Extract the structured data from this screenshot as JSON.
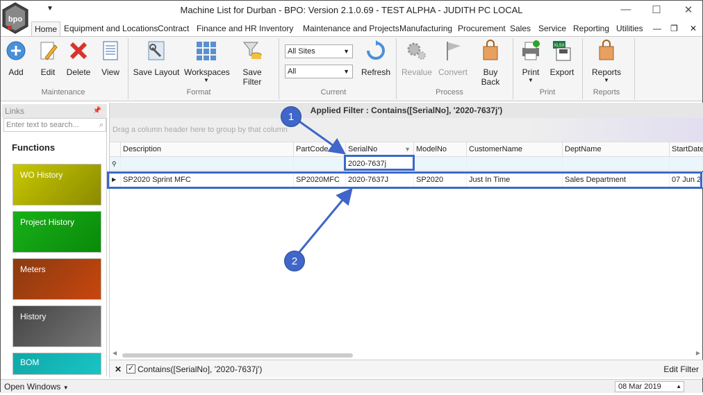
{
  "window": {
    "title": "Machine List for Durban - BPO: Version 2.1.0.69 - TEST ALPHA - JUDITH PC LOCAL",
    "logo_text": "bpo"
  },
  "menu": {
    "tabs": [
      "Home",
      "Equipment and Locations",
      "Contract",
      "Finance and HR",
      "Inventory",
      "Maintenance and Projects",
      "Manufacturing",
      "Procurement",
      "Sales",
      "Service",
      "Reporting",
      "Utilities"
    ]
  },
  "ribbon": {
    "maintenance": {
      "add": "Add",
      "edit": "Edit",
      "delete": "Delete",
      "view": "View",
      "label": "Maintenance"
    },
    "format": {
      "save_layout": "Save Layout",
      "workspaces": "Workspaces",
      "save_filter": "Save Filter",
      "label": "Format"
    },
    "current": {
      "site_value": "All Sites",
      "filter_value": "All",
      "refresh": "Refresh",
      "label": "Current"
    },
    "process": {
      "revalue": "Revalue",
      "convert": "Convert",
      "buy_back": "Buy Back",
      "label": "Process"
    },
    "print": {
      "print": "Print",
      "export": "Export",
      "label": "Print"
    },
    "reports": {
      "reports": "Reports",
      "label": "Reports"
    }
  },
  "links": {
    "header": "Links",
    "search_placeholder": "Enter text to search...",
    "functions_title": "Functions",
    "tiles": [
      {
        "label": "WO History",
        "color": "#a8a800"
      },
      {
        "label": "Project History",
        "color": "#12a012"
      },
      {
        "label": "Meters",
        "color": "#b0440f"
      },
      {
        "label": "History",
        "color": "#555555"
      },
      {
        "label": "BOM",
        "color": "#11b4b4"
      }
    ]
  },
  "grid": {
    "applied_filter": "Applied Filter : Contains([SerialNo], '2020-7637j')",
    "group_hint": "Drag a column header here to group by that column",
    "columns": [
      "Description",
      "PartCode",
      "SerialNo",
      "ModelNo",
      "CustomerName",
      "DeptName",
      "StartDate"
    ],
    "filter_value": "2020-7637j",
    "rows": [
      [
        "SP2020 Sprint MFC",
        "SP2020MFC",
        "2020-7637J",
        "SP2020",
        "Just In Time",
        "Sales Department",
        "07 Jun 2"
      ]
    ],
    "filter_bar_text": "Contains([SerialNo], '2020-7637j')",
    "edit_filter": "Edit Filter"
  },
  "callouts": [
    "1",
    "2"
  ],
  "status": {
    "open_windows": "Open Windows",
    "date": "08 Mar 2019"
  }
}
